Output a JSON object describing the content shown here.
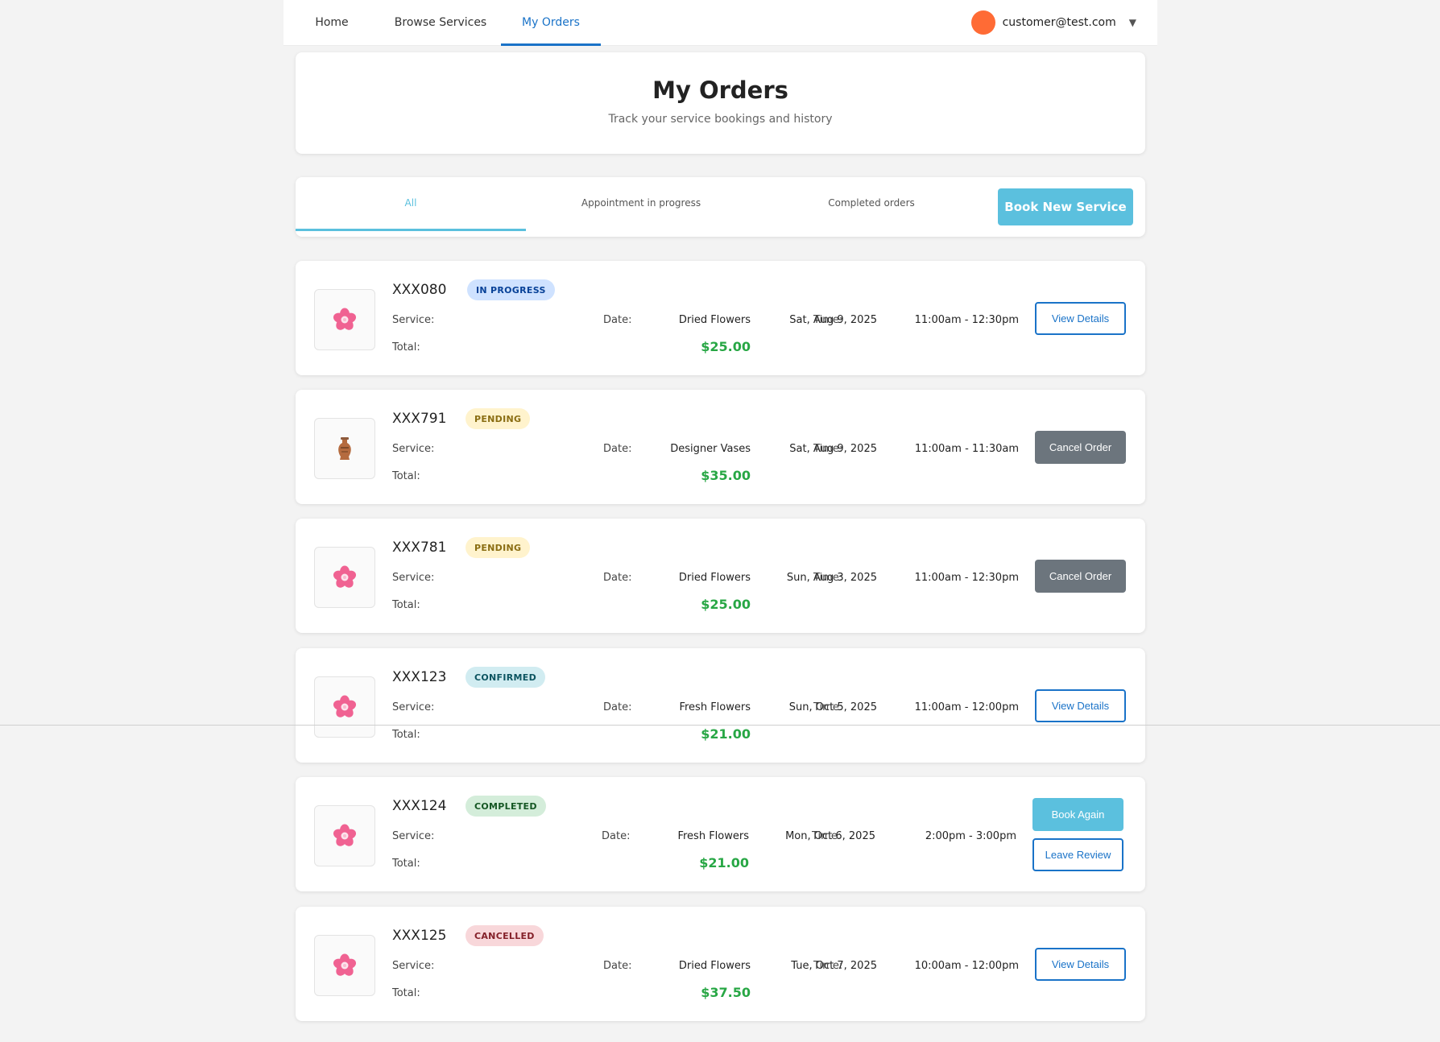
{
  "nav": {
    "home": "Home",
    "browse": "Browse Services",
    "orders": "My Orders",
    "user_email": "customer@test.com",
    "caret": "▼",
    "avatar_color": "#ff6b35"
  },
  "header": {
    "title": "My Orders",
    "subtitle": "Track your service bookings and history"
  },
  "tabs": {
    "all": "All",
    "in_progress": "Appointment in progress",
    "completed": "Completed orders",
    "book_new": "Book New Service"
  },
  "labels": {
    "service": "Service:",
    "date": "Date:",
    "time": "Time:",
    "total": "Total:"
  },
  "orders": [
    {
      "id": "XXX080",
      "status": "IN PROGRESS",
      "status_kind": "in-progress",
      "icon": "flower-icon",
      "service": "Dried Flowers",
      "date": "Sat, Aug 9, 2025",
      "time": "11:00am - 12:30pm",
      "total": "$25.00",
      "actions": [
        "View Details"
      ]
    },
    {
      "id": "XXX791",
      "status": "PENDING",
      "status_kind": "pending",
      "icon": "vase-icon",
      "service": "Designer Vases",
      "date": "Sat, Aug 9, 2025",
      "time": "11:00am - 11:30am",
      "total": "$35.00",
      "actions": [
        "Cancel Order"
      ]
    },
    {
      "id": "XXX781",
      "status": "PENDING",
      "status_kind": "pending",
      "icon": "flower-icon",
      "service": "Dried Flowers",
      "date": "Sun, Aug 3, 2025",
      "time": "11:00am - 12:30pm",
      "total": "$25.00",
      "actions": [
        "Cancel Order"
      ]
    },
    {
      "id": "XXX123",
      "status": "CONFIRMED",
      "status_kind": "confirmed",
      "icon": "flower-icon",
      "service": "Fresh Flowers",
      "date": "Sun, Oct 5, 2025",
      "time": "11:00am - 12:00pm",
      "total": "$21.00",
      "actions": [
        "View Details"
      ]
    },
    {
      "id": "XXX124",
      "status": "COMPLETED",
      "status_kind": "completed",
      "icon": "flower-icon",
      "service": "Fresh Flowers",
      "date": "Mon, Oct 6, 2025",
      "time": "2:00pm - 3:00pm",
      "total": "$21.00",
      "actions": [
        "Book Again",
        "Leave Review"
      ]
    },
    {
      "id": "XXX125",
      "status": "CANCELLED",
      "status_kind": "cancelled",
      "icon": "flower-icon",
      "service": "Dried Flowers",
      "date": "Tue, Oct 7, 2025",
      "time": "10:00am - 12:00pm",
      "total": "$37.50",
      "actions": [
        "View Details"
      ]
    }
  ],
  "colors": {
    "accent": "#1a73c8",
    "info": "#5bc0de",
    "price": "#28a745",
    "dark_button": "#6c757d"
  }
}
